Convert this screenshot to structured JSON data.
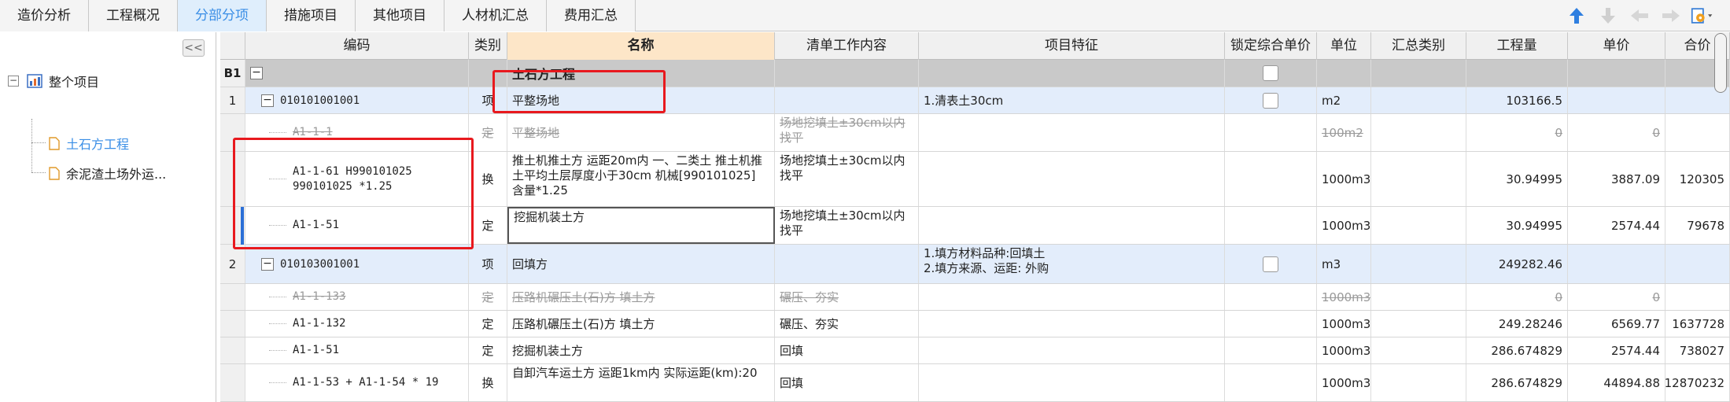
{
  "tabs": [
    "造价分析",
    "工程概况",
    "分部分项",
    "措施项目",
    "其他项目",
    "人材机汇总",
    "费用汇总"
  ],
  "active_tab": 2,
  "toolbar_icons": [
    "arrow-up-icon",
    "arrow-down-icon",
    "arrow-left-icon",
    "arrow-right-icon",
    "settings-dropdown-icon"
  ],
  "tree": {
    "collapse_label": "<<",
    "root_label": "整个项目",
    "children": [
      "土石方工程",
      "余泥渣土场外运..."
    ]
  },
  "columns": {
    "rownum": "",
    "code": "编码",
    "type": "类别",
    "name": "名称",
    "work": "清单工作内容",
    "feature": "项目特征",
    "lock": "锁定综合单价",
    "unit": "单位",
    "summary": "汇总类别",
    "qty": "工程量",
    "price": "单价",
    "total": "合价"
  },
  "rows": [
    {
      "kind": "section",
      "num": "B1",
      "code": "",
      "type": "",
      "name": "土石方工程",
      "work": "",
      "feature": "",
      "lock": true,
      "unit": "",
      "qty": "",
      "price": "",
      "total": ""
    },
    {
      "kind": "item",
      "num": "1",
      "code": "010101001001",
      "type": "项",
      "name": "平整场地",
      "work": "",
      "feature": "1.清表土30cm",
      "lock": true,
      "unit": "m2",
      "qty": "103166.5",
      "price": "",
      "total": ""
    },
    {
      "kind": "sub-struck",
      "num": "",
      "code": "A1-1-1",
      "type": "定",
      "name": "平整场地",
      "work": "场地挖填土±30cm以内找平",
      "feature": "",
      "lock": false,
      "unit": "100m2",
      "qty": "0",
      "price": "0",
      "total": ""
    },
    {
      "kind": "sub",
      "num": "",
      "code": "A1-1-61 H990101025 990101025 *1.25",
      "type": "换",
      "name": "推土机推土方 运距20m内 一、二类土 推土机推土平均土层厚度小于30cm 机械[990101025] 含量*1.25",
      "work": "场地挖填土±30cm以内找平",
      "feature": "",
      "lock": false,
      "unit": "1000m3",
      "qty": "30.94995",
      "price": "3887.09",
      "total": "120305"
    },
    {
      "kind": "sub",
      "num": "",
      "code": "A1-1-51",
      "type": "定",
      "name": "挖掘机装土方",
      "work": "场地挖填土±30cm以内找平",
      "feature": "",
      "lock": false,
      "unit": "1000m3",
      "qty": "30.94995",
      "price": "2574.44",
      "total": "79678"
    },
    {
      "kind": "item",
      "num": "2",
      "code": "010103001001",
      "type": "项",
      "name": "回填方",
      "work": "",
      "feature": "1.填方材料品种:回填土\n2.填方来源、运距: 外购",
      "lock": true,
      "unit": "m3",
      "qty": "249282.46",
      "price": "",
      "total": ""
    },
    {
      "kind": "sub-struck",
      "num": "",
      "code": "A1-1-133",
      "type": "定",
      "name": "压路机碾压土(石)方 填土方",
      "work": "碾压、夯实",
      "feature": "",
      "lock": false,
      "unit": "1000m3",
      "qty": "0",
      "price": "0",
      "total": ""
    },
    {
      "kind": "sub",
      "num": "",
      "code": "A1-1-132",
      "type": "定",
      "name": "压路机碾压土(石)方 填土方",
      "work": "碾压、夯实",
      "feature": "",
      "lock": false,
      "unit": "1000m3",
      "qty": "249.28246",
      "price": "6569.77",
      "total": "1637728"
    },
    {
      "kind": "sub",
      "num": "",
      "code": "A1-1-51",
      "type": "定",
      "name": "挖掘机装土方",
      "work": "回填",
      "feature": "",
      "lock": false,
      "unit": "1000m3",
      "qty": "286.674829",
      "price": "2574.44",
      "total": "738027"
    },
    {
      "kind": "sub",
      "num": "",
      "code": "A1-1-53 + A1-1-54 * 19",
      "type": "换",
      "name": "自卸汽车运土方 运距1km内  实际运距(km):20",
      "work": "回填",
      "feature": "",
      "lock": false,
      "unit": "1000m3",
      "qty": "286.674829",
      "price": "44894.88",
      "total": "12870232"
    }
  ],
  "colors": {
    "accent": "#3a8ee6",
    "highlight": "#e8191e",
    "item_row": "#e3edfb",
    "section_row": "#c9c9c9"
  }
}
